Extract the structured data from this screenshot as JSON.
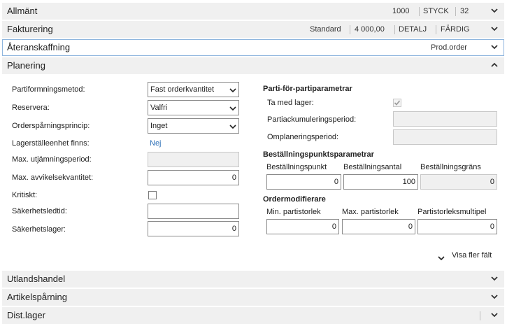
{
  "sections": {
    "allmant": {
      "title": "Allmänt",
      "values": [
        "1000",
        "STYCK",
        "32"
      ]
    },
    "fakturering": {
      "title": "Fakturering",
      "values": [
        "Standard",
        "4 000,00",
        "DETALJ",
        "FÄRDIG"
      ]
    },
    "ateranskaffning": {
      "title": "Återanskaffning",
      "values": [
        "Prod.order"
      ]
    },
    "planering": {
      "title": "Planering"
    },
    "utlandshandel": {
      "title": "Utlandshandel"
    },
    "artikelsparning": {
      "title": "Artikelspårning"
    },
    "distlager": {
      "title": "Dist.lager"
    }
  },
  "left": {
    "partiformning": {
      "label": "Partiformningsmetod:",
      "value": "Fast orderkvantitet"
    },
    "reservera": {
      "label": "Reservera:",
      "value": "Valfri"
    },
    "orderspar": {
      "label": "Orderspårningsprincip:",
      "value": "Inget"
    },
    "lagerstalle": {
      "label": "Lagerställeenhet finns:",
      "value": "Nej"
    },
    "maxutj": {
      "label": "Max. utjämningsperiod:",
      "value": ""
    },
    "maxavv": {
      "label": "Max. avvikelsekvantitet:",
      "value": "0"
    },
    "kritiskt": {
      "label": "Kritiskt:",
      "checked": false
    },
    "sakerhetsledtid": {
      "label": "Säkerhetsledtid:",
      "value": ""
    },
    "sakerhetslager": {
      "label": "Säkerhetslager:",
      "value": "0"
    }
  },
  "right": {
    "pfp": {
      "title": "Parti-för-partiparametrar",
      "tamed": {
        "label": "Ta med lager:",
        "checked": true
      },
      "partiack": {
        "label": "Partiackumuleringsperiod:",
        "value": ""
      },
      "omplan": {
        "label": "Omplaneringsperiod:",
        "value": ""
      }
    },
    "bp": {
      "title": "Beställningspunktsparametrar",
      "cols": [
        {
          "label": "Beställningspunkt",
          "value": "0"
        },
        {
          "label": "Beställningsantal",
          "value": "100"
        },
        {
          "label": "Beställningsgräns",
          "value": "0"
        }
      ]
    },
    "om": {
      "title": "Ordermodifierare",
      "cols": [
        {
          "label": "Min. partistorlek",
          "value": "0"
        },
        {
          "label": "Max. partistorlek",
          "value": "0"
        },
        {
          "label": "Partistorleksmultipel",
          "value": "0"
        }
      ]
    }
  },
  "show_more": "Visa fler fält",
  "colors": {
    "header_bg": "#f0f0f0",
    "selected_border": "#8fb6de",
    "link": "#2f71b8"
  },
  "icons": {
    "expand": "chevron-down-icon",
    "collapse": "chevron-up-icon"
  }
}
